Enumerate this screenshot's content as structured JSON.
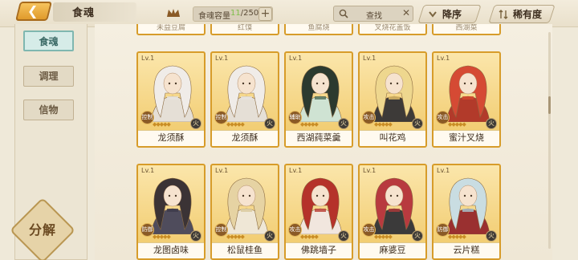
{
  "header": {
    "title": "食魂",
    "capacity_label": "食魂容量",
    "capacity_current": "11",
    "capacity_sep_max": "/250",
    "plus_label": "+",
    "search_placeholder": "查找",
    "clear_label": "✕",
    "sort_desc_label": "降序",
    "sort_rarity_label": "稀有度",
    "back_glyph": "❮"
  },
  "sidebar": {
    "tabs": [
      {
        "label": "食魂",
        "active": true
      },
      {
        "label": "调理",
        "active": false
      },
      {
        "label": "信物",
        "active": false
      }
    ],
    "decompose_label": "分解"
  },
  "cards": {
    "top_partial": [
      {
        "name": "未益豆腐"
      },
      {
        "name": "红馍"
      },
      {
        "name": "鱼腐烧"
      },
      {
        "name": "叉烧花盖饭"
      },
      {
        "name": "西湖菜"
      }
    ],
    "row1": [
      {
        "name": "龙须酥",
        "level": "Lv.1",
        "role": "控制",
        "accent": "#e7e3df",
        "hair": "#f0ece8",
        "cloth": "#e5dfd6"
      },
      {
        "name": "龙须酥",
        "level": "Lv.1",
        "role": "控制",
        "accent": "#e7e3df",
        "hair": "#f0ece8",
        "cloth": "#e5dfd6"
      },
      {
        "name": "西湖莼菜羹",
        "level": "Lv.1",
        "role": "辅助",
        "accent": "#4c6b55",
        "hair": "#2c3a2f",
        "cloth": "#cfe3d3"
      },
      {
        "name": "叫花鸡",
        "level": "Lv.1",
        "role": "攻击",
        "accent": "#e8c36a",
        "hair": "#eed78e",
        "cloth": "#3d3a38"
      },
      {
        "name": "蜜汁叉烧",
        "level": "Lv.1",
        "role": "攻击",
        "accent": "#d2492e",
        "hair": "#d54a34",
        "cloth": "#b23a2a"
      }
    ],
    "row2": [
      {
        "name": "龙图卤味",
        "level": "Lv.1",
        "role": "防御",
        "accent": "#3c3a4a",
        "hair": "#3b3335",
        "cloth": "#4f4c5c"
      },
      {
        "name": "松鼠桂鱼",
        "level": "Lv.1",
        "role": "控制",
        "accent": "#d9c99b",
        "hair": "#e6d3a3",
        "cloth": "#efe7d6"
      },
      {
        "name": "佛跳墙子",
        "level": "Lv.1",
        "role": "攻击",
        "accent": "#b83a2e",
        "hair": "#b5322a",
        "cloth": "#f1e6de"
      },
      {
        "name": "麻婆豆",
        "level": "Lv.1",
        "role": "攻击",
        "accent": "#b23a3a",
        "hair": "#b83a3f",
        "cloth": "#3b3a3a"
      },
      {
        "name": "云片糕",
        "level": "Lv.1",
        "role": "防御",
        "accent": "#a8c9d3",
        "hair": "#c9dde2",
        "cloth": "#9a3030"
      }
    ],
    "star_glyphs": "◆◆◆◆◆",
    "grade_label": "火"
  },
  "colors": {
    "card_border": "#d79c2a",
    "active_tab": "#7fb7b0",
    "accent_gold": "#e09b2c"
  }
}
